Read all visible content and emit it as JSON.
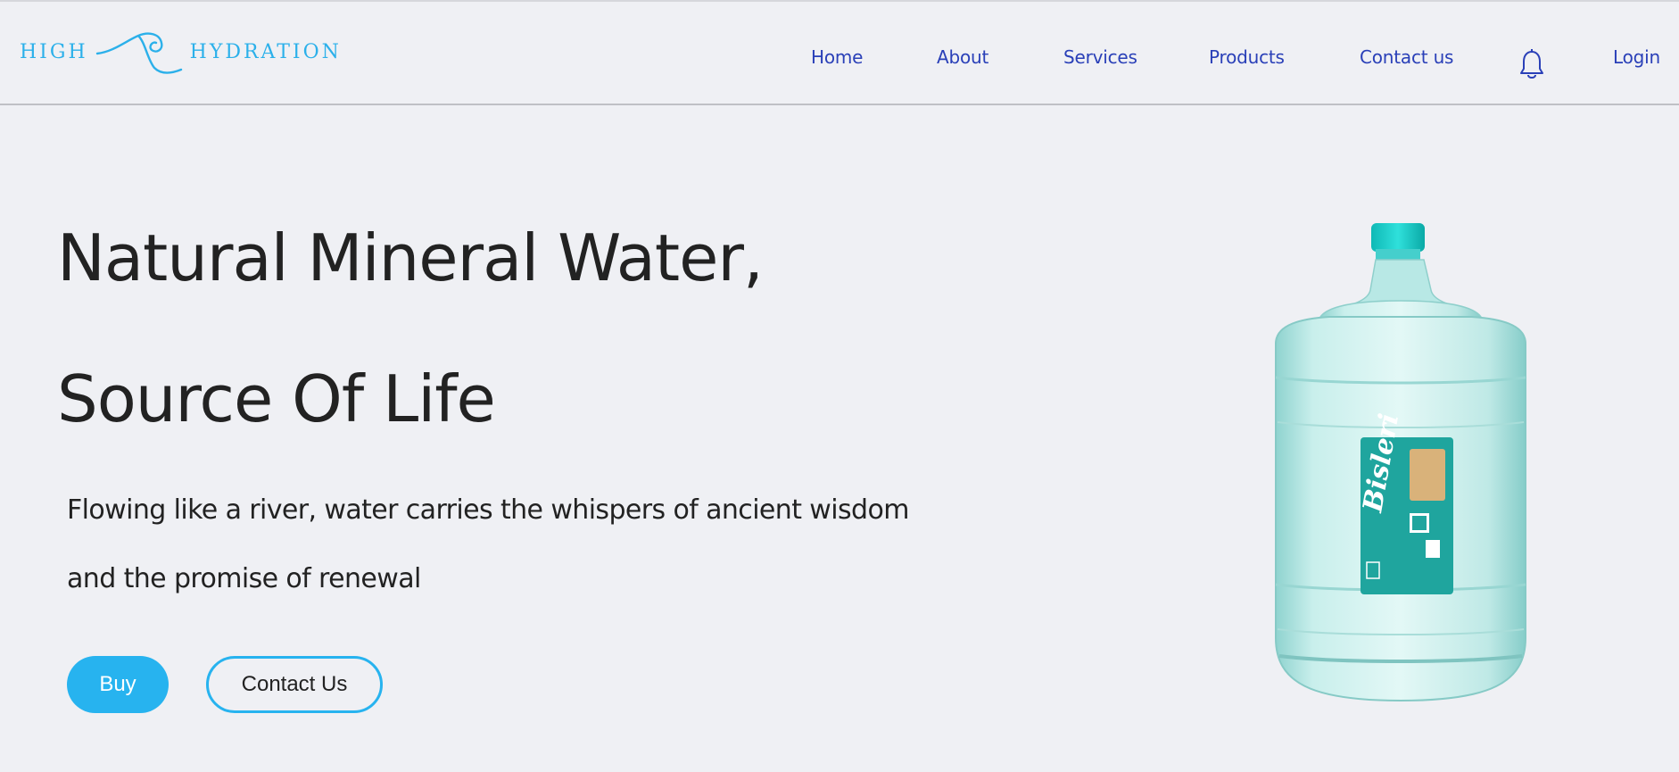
{
  "brand": {
    "left": "HIGH",
    "right": "HYDRATION"
  },
  "nav": {
    "home": "Home",
    "about": "About",
    "services": "Services",
    "products": "Products",
    "contact": "Contact us",
    "login": "Login",
    "bell_icon": "bell-icon"
  },
  "hero": {
    "title_line1": "Natural Mineral Water,",
    "title_line2": "Source Of Life",
    "sub_line1": "Flowing like a river, water carries the whispers of ancient wisdom",
    "sub_line2": "and the promise of renewal",
    "buy_label": "Buy",
    "contact_label": "Contact Us"
  },
  "product_label": {
    "brand": "Bisleri"
  },
  "colors": {
    "accent": "#27b3ef",
    "nav": "#2a40b8",
    "text": "#222222",
    "bg": "#eff0f4"
  }
}
